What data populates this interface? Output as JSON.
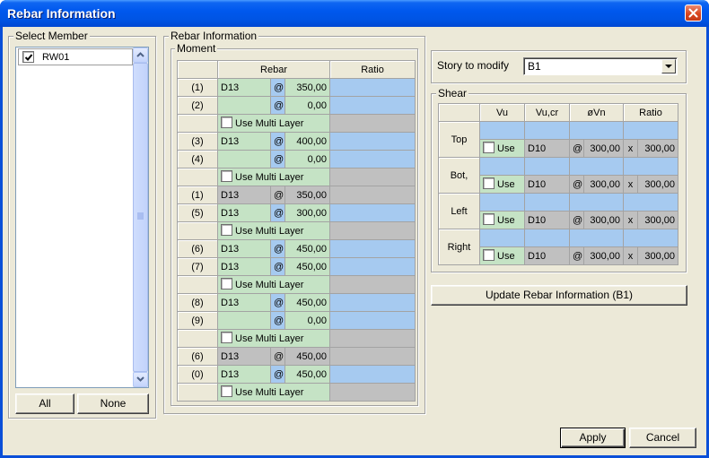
{
  "window": {
    "title": "Rebar Information",
    "close_icon": "close-icon"
  },
  "select_member": {
    "label": "Select Member",
    "items": [
      {
        "name": "RW01",
        "checked": true
      }
    ],
    "all_button": "All",
    "none_button": "None",
    "scroll_up_icon": "scroll-up-arrow-icon",
    "scroll_down_icon": "scroll-down-arrow-icon"
  },
  "rebar_information": {
    "label": "Rebar Information"
  },
  "moment": {
    "label": "Moment",
    "header_rebar": "Rebar",
    "header_ratio": "Ratio",
    "at_symbol": "@",
    "multi_layer_label": "Use Multi Layer",
    "rows": [
      {
        "type": "bar",
        "label": "(1)",
        "dia": "D13",
        "spacing": "350,00",
        "enabled": true
      },
      {
        "type": "bar",
        "label": "(2)",
        "dia": "",
        "spacing": "0,00",
        "enabled": true
      },
      {
        "type": "multi_layer",
        "checked": false
      },
      {
        "type": "bar",
        "label": "(3)",
        "dia": "D13",
        "spacing": "400,00",
        "enabled": true
      },
      {
        "type": "bar",
        "label": "(4)",
        "dia": "",
        "spacing": "0,00",
        "enabled": true
      },
      {
        "type": "multi_layer",
        "checked": false
      },
      {
        "type": "bar",
        "label": "(1)",
        "dia": "D13",
        "spacing": "350,00",
        "enabled": false
      },
      {
        "type": "bar",
        "label": "(5)",
        "dia": "D13",
        "spacing": "300,00",
        "enabled": true
      },
      {
        "type": "multi_layer",
        "checked": false
      },
      {
        "type": "bar",
        "label": "(6)",
        "dia": "D13",
        "spacing": "450,00",
        "enabled": true
      },
      {
        "type": "bar",
        "label": "(7)",
        "dia": "D13",
        "spacing": "450,00",
        "enabled": true
      },
      {
        "type": "multi_layer",
        "checked": false
      },
      {
        "type": "bar",
        "label": "(8)",
        "dia": "D13",
        "spacing": "450,00",
        "enabled": true
      },
      {
        "type": "bar",
        "label": "(9)",
        "dia": "",
        "spacing": "0,00",
        "enabled": true
      },
      {
        "type": "multi_layer",
        "checked": false
      },
      {
        "type": "bar",
        "label": "(6)",
        "dia": "D13",
        "spacing": "450,00",
        "enabled": false
      },
      {
        "type": "bar",
        "label": "(0)",
        "dia": "D13",
        "spacing": "450,00",
        "enabled": true
      },
      {
        "type": "multi_layer",
        "checked": false
      }
    ]
  },
  "story": {
    "label": "Story to modify",
    "value": "B1",
    "dropdown_icon": "dropdown-arrow-icon"
  },
  "shear": {
    "label": "Shear",
    "headers": [
      "Vu",
      "Vu,cr",
      "øVn",
      "Ratio"
    ],
    "use_label": "Use",
    "at_symbol": "@",
    "x_symbol": "x",
    "rows": [
      {
        "label": "Top",
        "use_checked": false,
        "dia": "D10",
        "spacing": "300,00",
        "dimension": "300,00"
      },
      {
        "label": "Bot,",
        "use_checked": false,
        "dia": "D10",
        "spacing": "300,00",
        "dimension": "300,00"
      },
      {
        "label": "Left",
        "use_checked": false,
        "dia": "D10",
        "spacing": "300,00",
        "dimension": "300,00"
      },
      {
        "label": "Right",
        "use_checked": false,
        "dia": "D10",
        "spacing": "300,00",
        "dimension": "300,00"
      }
    ]
  },
  "buttons": {
    "update": "Update Rebar Information (B1)",
    "apply": "Apply",
    "cancel": "Cancel"
  },
  "colors": {
    "title_bar": "#0054E3",
    "dialog_background": "#ECE9D8",
    "cell_input": "#C5E3C5",
    "cell_result": "#A6CAF0",
    "cell_disabled": "#C0C0C0",
    "close_button": "#D9461F"
  }
}
